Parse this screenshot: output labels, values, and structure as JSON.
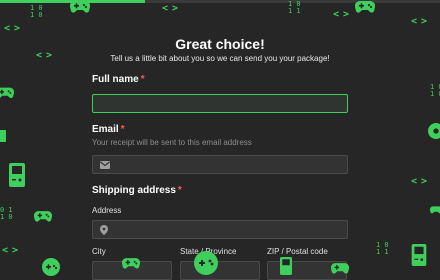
{
  "progress": {
    "fraction": 0.33
  },
  "form": {
    "title": "Great choice!",
    "subtitle": "Tell us a little bit about you so we can send you your package!",
    "required_marker": "*",
    "full_name": {
      "label": "Full name",
      "value": ""
    },
    "email": {
      "label": "Email",
      "help": "Your receipt will be sent to this email address",
      "value": "",
      "icon": "envelope-icon"
    },
    "shipping": {
      "label": "Shipping address",
      "address": {
        "label": "Address",
        "value": "",
        "icon": "map-pin-icon"
      },
      "city": {
        "label": "City",
        "value": ""
      },
      "state": {
        "label": "State / Province",
        "value": ""
      },
      "zip": {
        "label": "ZIP / Postal code",
        "value": ""
      }
    }
  },
  "decorations": {
    "code_glyph": "< >",
    "binary_a": "1 0\n1 0",
    "binary_b": "1 0\n1 1",
    "binary_c": "0 1\n1 0"
  },
  "colors": {
    "accent": "#3ecf5c",
    "background": "#262626",
    "required": "#ff5a5a"
  }
}
